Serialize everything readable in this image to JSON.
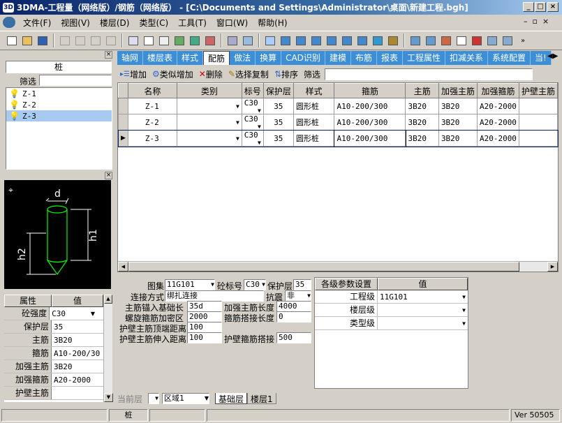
{
  "title": "3DMA-工程量（网络版）/钢筋（网络版） - [C:\\Documents and Settings\\Administrator\\桌面\\新建工程.bgh]",
  "menu": [
    "文件(F)",
    "视图(V)",
    "楼层(D)",
    "类型(C)",
    "工具(T)",
    "窗口(W)",
    "帮助(H)"
  ],
  "left_panel": {
    "header": "桩",
    "filter_label": "筛选",
    "items": [
      "Z-1",
      "Z-2",
      "Z-3"
    ],
    "diagram_labels": {
      "d": "d",
      "h1": "h1",
      "h2": "h2"
    },
    "prop_header": [
      "属性",
      "值"
    ],
    "props": [
      {
        "k": "砼强度",
        "v": "C30"
      },
      {
        "k": "保护层",
        "v": "35"
      },
      {
        "k": "主筋",
        "v": "3B20"
      },
      {
        "k": "箍筋",
        "v": "A10-200/30"
      },
      {
        "k": "加强主筋",
        "v": "3B20"
      },
      {
        "k": "加强箍筋",
        "v": "A20-2000"
      },
      {
        "k": "护壁主筋",
        "v": ""
      }
    ]
  },
  "tabs": [
    "轴网",
    "楼层表",
    "样式",
    "配筋",
    "做法",
    "换算",
    "CAD识别",
    "建模",
    "布筋",
    "报表",
    "工程属性",
    "扣减关系",
    "系统配置",
    "当!"
  ],
  "active_tab": "配筋",
  "actions": {
    "add": "增加",
    "similar": "类似增加",
    "delete": "删除",
    "copy": "选择复制",
    "sort": "排序",
    "filter": "筛选"
  },
  "columns": [
    "名称",
    "类别",
    "标号",
    "保护层",
    "样式",
    "箍筋",
    "主筋",
    "加强主筋",
    "加强箍筋",
    "护壁主筋"
  ],
  "rows": [
    {
      "name": "Z-1",
      "cat": "",
      "grade": "C30",
      "cover": "35",
      "style": "圆形桩",
      "stirrup": "A10-200/300",
      "main": "3B20",
      "extra_main": "3B20",
      "extra_stirrup": "A20-2000",
      "wall": ""
    },
    {
      "name": "Z-2",
      "cat": "",
      "grade": "C30",
      "cover": "35",
      "style": "圆形桩",
      "stirrup": "A10-200/300",
      "main": "3B20",
      "extra_main": "3B20",
      "extra_stirrup": "A20-2000",
      "wall": ""
    },
    {
      "name": "Z-3",
      "cat": "",
      "grade": "C30",
      "cover": "35",
      "style": "圆形桩",
      "stirrup": "A10-200/300",
      "main": "3B20",
      "extra_main": "3B20",
      "extra_stirrup": "A20-2000",
      "wall": ""
    }
  ],
  "form": {
    "atlas_label": "图集",
    "atlas": "11G101",
    "grade_label": "砼标号",
    "grade": "C30",
    "cover_label": "保护层",
    "cover": "35",
    "conn_label": "连接方式",
    "conn": "绑扎连接",
    "seismic_label": "抗震",
    "seismic": "非",
    "anchor_label": "主筋锚入基础长",
    "anchor": "35d",
    "extra_len_label": "加强主筋长度",
    "extra_len": "4000",
    "spiral_label": "螺旋箍筋加密区",
    "spiral": "2000",
    "lap_label": "箍筋搭接长度",
    "lap": "0",
    "wall_top_label": "护壁主筋顶端距离",
    "wall_top": "100",
    "wall_in_label": "护壁主筋伸入距离",
    "wall_in": "100",
    "wall_lap_label": "护壁箍筋搭接",
    "wall_lap": "500"
  },
  "params": {
    "header": [
      "各级参数设置",
      "值"
    ],
    "rows": [
      {
        "k": "工程级",
        "v": "11G101"
      },
      {
        "k": "楼层级",
        "v": ""
      },
      {
        "k": "类型级",
        "v": ""
      }
    ]
  },
  "bottom": {
    "floor_label": "当前层",
    "region": "区域1",
    "tabs": [
      "基础层",
      "楼层1"
    ]
  },
  "status": {
    "item": "桩",
    "version": "Ver 50505"
  }
}
